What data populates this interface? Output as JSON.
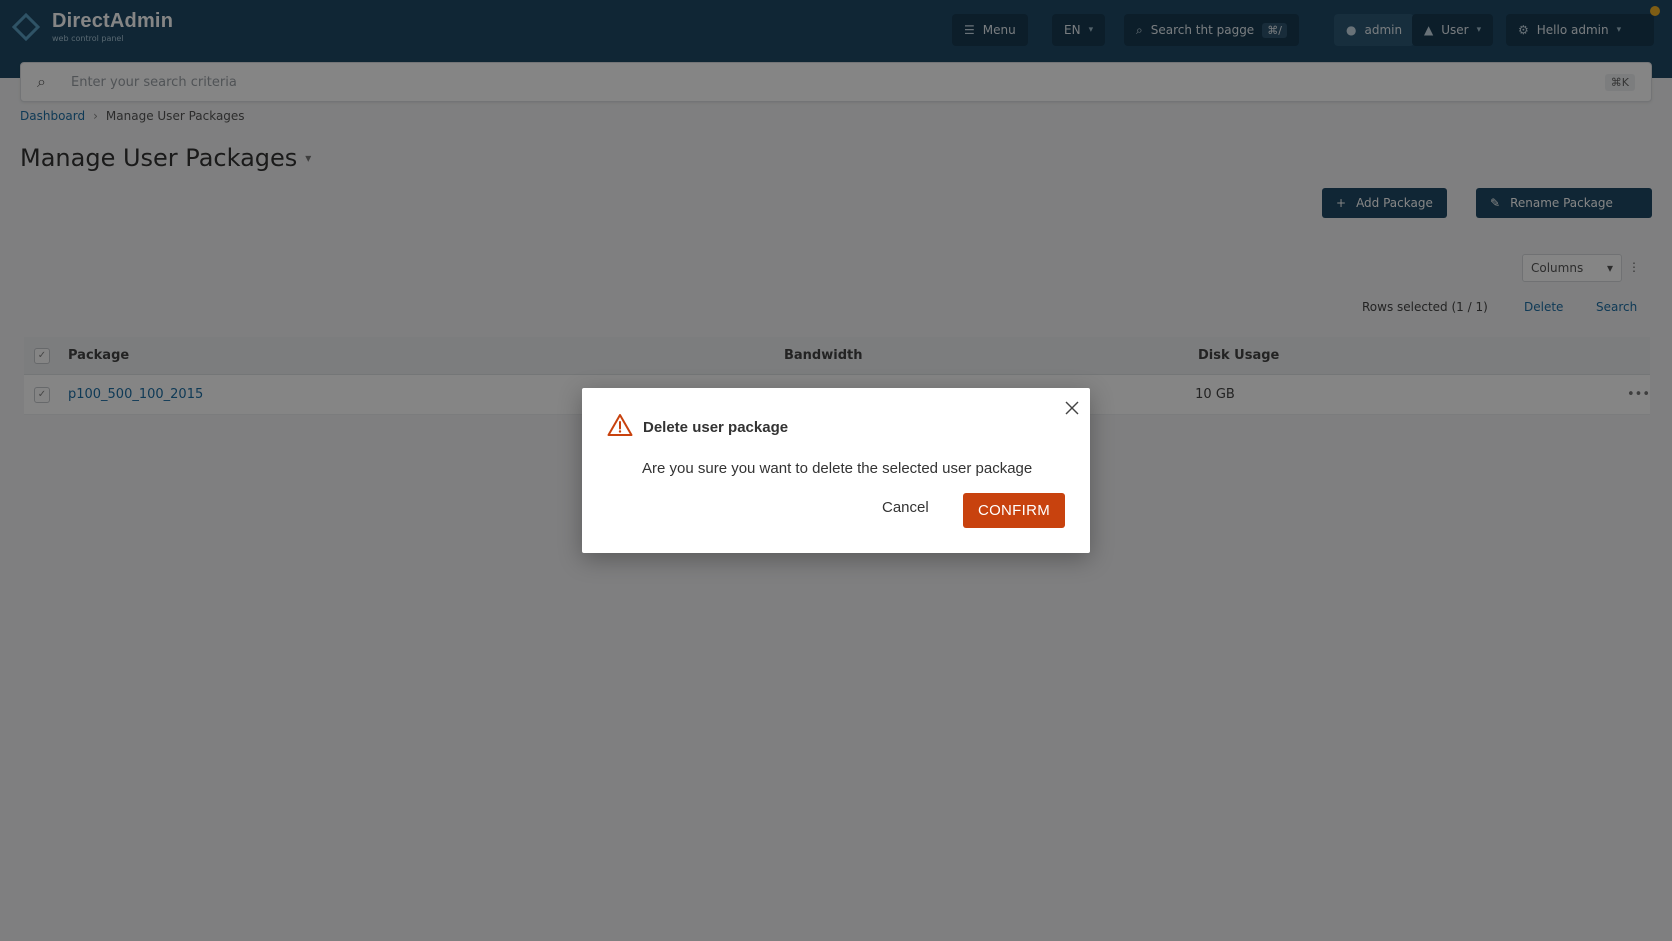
{
  "header": {
    "logo_title": "DirectAdmin",
    "logo_subtitle": "web control panel",
    "menu_label": "Menu",
    "language": "EN",
    "search_page_label": "Search tht pagge",
    "search_page_shortcut": "⌘/",
    "users_label": "admin",
    "user_role": "User",
    "account_label": "Hello admin"
  },
  "search": {
    "placeholder": "Enter your search criteria",
    "shortcut": "⌘K"
  },
  "breadcrumb": {
    "root": "Dashboard",
    "current": "Manage User Packages"
  },
  "page": {
    "title": "Manage User Packages"
  },
  "actions": {
    "add_package": "Add Package",
    "rename_package": "Rename Package"
  },
  "controls": {
    "columns_label": "Columns",
    "rows_selected": "Rows selected (1 / 1)",
    "delete_label": "Delete",
    "search_label": "Search"
  },
  "table": {
    "headers": [
      "Package",
      "Bandwidth",
      "Disk Usage"
    ],
    "rows": [
      {
        "package": "p100_500_100_2015",
        "bandwidth": "",
        "disk_usage": "10 GB",
        "more": "•••"
      }
    ]
  },
  "modal": {
    "title": "Delete user package",
    "message": "Are you sure you want to delete the selected user package",
    "cancel_label": "Cancel",
    "confirm_label": "CONFIRM"
  },
  "colors": {
    "header_bg": "#1f4a66",
    "confirm_bg": "#c8420e",
    "warning_icon": "#c8420e",
    "link": "#1e6fa6"
  },
  "icons": {
    "modal": "warning-triangle-icon",
    "close": "close-icon",
    "search": "search-icon"
  }
}
